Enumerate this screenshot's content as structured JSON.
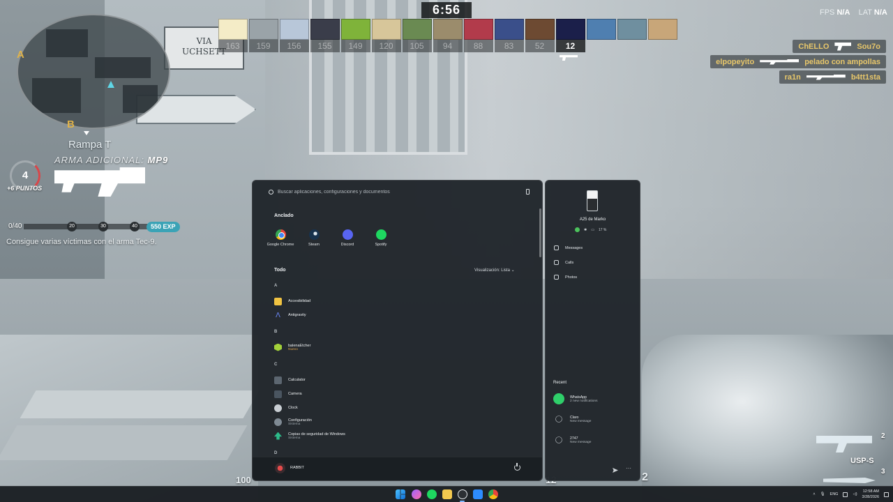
{
  "game": {
    "timer": "6:56",
    "location": "Rampa T",
    "street_sign": "VIA\nUCHSETT",
    "minimap": {
      "site_a": "A",
      "site_b": "B"
    },
    "fps_label": "FPS",
    "fps_value": "N/A",
    "lat_label": "LAT",
    "lat_value": "N/A",
    "scoreboard": [
      {
        "score": "163",
        "color": "#f4ecc7"
      },
      {
        "score": "159",
        "color": "#9aa3a8"
      },
      {
        "score": "156",
        "color": "#b8c7d9"
      },
      {
        "score": "155",
        "color": "#3a3d4a"
      },
      {
        "score": "149",
        "color": "#7fb33a"
      },
      {
        "score": "120",
        "color": "#d7c69a"
      },
      {
        "score": "105",
        "color": "#6a8a52"
      },
      {
        "score": "94",
        "color": "#9b8c6c"
      },
      {
        "score": "88",
        "color": "#b23b4b"
      },
      {
        "score": "83",
        "color": "#3a4f8a"
      },
      {
        "score": "52",
        "color": "#6d4a32"
      },
      {
        "score": "12",
        "color": "#1b1f4a"
      },
      {
        "score": "",
        "color": "#4f7fb0"
      },
      {
        "score": "",
        "color": "#6f8f9f"
      },
      {
        "score": "",
        "color": "#c8a679"
      }
    ],
    "killfeed": [
      {
        "killer": "ChELLO",
        "victim": "Sou7o",
        "weapon": "pistol"
      },
      {
        "killer": "elpopeyito",
        "victim": "pelado con ampollas",
        "weapon": "rifle"
      },
      {
        "killer": "ra1n",
        "victim": "b4tt1sta",
        "weapon": "rifle"
      }
    ],
    "kills": "4",
    "points": "+6 PUNTOS",
    "weapon_prefix": "ARMA ADICIONAL:",
    "weapon_name": "MP9",
    "progress_current": "0/40",
    "milestones": [
      "20",
      "30",
      "40"
    ],
    "exp": "550 EXP",
    "mission": "Consigue varias víctimas con el arma Tec-9.",
    "ammo_reserve": "100",
    "ammo_mid": "12",
    "ammo_right": "2",
    "weapon_slots": {
      "slot_top": "2",
      "current_name": "USP-S",
      "slot_bottom": "3"
    }
  },
  "start_menu": {
    "search_placeholder": "Buscar aplicaciones, configuraciones y documentos",
    "pinned_title": "Anclado",
    "pinned": [
      {
        "label": "Google Chrome"
      },
      {
        "label": "Steam"
      },
      {
        "label": "Discord"
      },
      {
        "label": "Spotify"
      }
    ],
    "all_title": "Todo",
    "view_label": "Visualización: Lista",
    "letters": [
      "A",
      "B",
      "C",
      "D"
    ],
    "apps": [
      {
        "name": "Accesibilidad",
        "sub": ""
      },
      {
        "name": "Antigravity",
        "sub": ""
      },
      {
        "name": "balenaEtcher",
        "sub": "Nuevo"
      },
      {
        "name": "Calculator",
        "sub": ""
      },
      {
        "name": "Camera",
        "sub": ""
      },
      {
        "name": "Clock",
        "sub": ""
      },
      {
        "name": "Configuración",
        "sub": "Sistema"
      },
      {
        "name": "Copias de seguridad de Windows",
        "sub": "Sistema"
      }
    ],
    "user_name": "RABBIT"
  },
  "phone_panel": {
    "device_name": "A25 de Marko",
    "battery": "17 %",
    "links": [
      "Messages",
      "Calls",
      "Photos"
    ],
    "recent_title": "Recent",
    "recent": [
      {
        "name": "WhatsApp",
        "sub": "2 new notifications"
      },
      {
        "name": "Claro",
        "sub": "New message"
      },
      {
        "name": "2747",
        "sub": "New message"
      }
    ]
  },
  "taskbar": {
    "language": "ENG",
    "time": "12:58 AM",
    "date": "3/28/2026"
  }
}
